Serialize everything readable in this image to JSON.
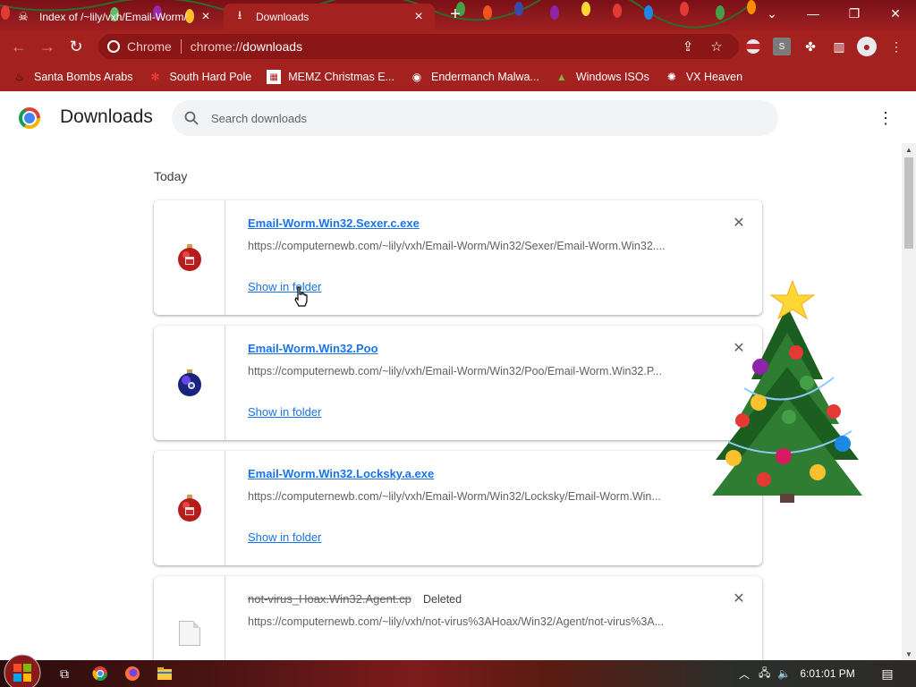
{
  "tabs": [
    {
      "label": "Index of /~lily/vxh/Email-Worm/",
      "icon": "skull-icon",
      "active": false
    },
    {
      "label": "Downloads",
      "icon": "download-icon",
      "active": true
    }
  ],
  "omnibox": {
    "site_label": "Chrome",
    "url_prefix": "chrome://",
    "url_path": "downloads"
  },
  "bookmarks": [
    {
      "label": "Santa Bombs Arabs",
      "icon": "fire-icon"
    },
    {
      "label": "South Hard Pole",
      "icon": "snowflake-icon"
    },
    {
      "label": "MEMZ Christmas E...",
      "icon": "memz-icon"
    },
    {
      "label": "Endermanch Malwa...",
      "icon": "raccoon-icon"
    },
    {
      "label": "Windows ISOs",
      "icon": "tree-icon"
    },
    {
      "label": "VX Heaven",
      "icon": "virus-icon"
    }
  ],
  "page": {
    "title": "Downloads",
    "search_placeholder": "Search downloads"
  },
  "downloads": {
    "day_label": "Today",
    "items": [
      {
        "filename": "Email-Worm.Win32.Sexer.c.exe",
        "url": "https://computernewb.com/~lily/vxh/Email-Worm/Win32/Sexer/Email-Worm.Win32....",
        "action": "Show in folder",
        "status": "",
        "icon": "red-ornament-icon"
      },
      {
        "filename": "Email-Worm.Win32.Poo",
        "url": "https://computernewb.com/~lily/vxh/Email-Worm/Win32/Poo/Email-Worm.Win32.P...",
        "action": "Show in folder",
        "status": "",
        "icon": "blue-ornament-icon"
      },
      {
        "filename": "Email-Worm.Win32.Locksky.a.exe",
        "url": "https://computernewb.com/~lily/vxh/Email-Worm/Win32/Locksky/Email-Worm.Win...",
        "action": "Show in folder",
        "status": "",
        "icon": "red-ornament-icon"
      },
      {
        "filename": "not-virus_Hoax.Win32.Agent.cp",
        "url": "https://computernewb.com/~lily/vxh/not-virus%3AHoax/Win32/Agent/not-virus%3A...",
        "action": "",
        "status": "Deleted",
        "icon": "generic-file-icon"
      }
    ]
  },
  "taskbar": {
    "time": "6:01:01 PM"
  },
  "colors": {
    "accent": "#a3211f",
    "link": "#1a73e8",
    "titlebar": "#8e1a1e"
  }
}
